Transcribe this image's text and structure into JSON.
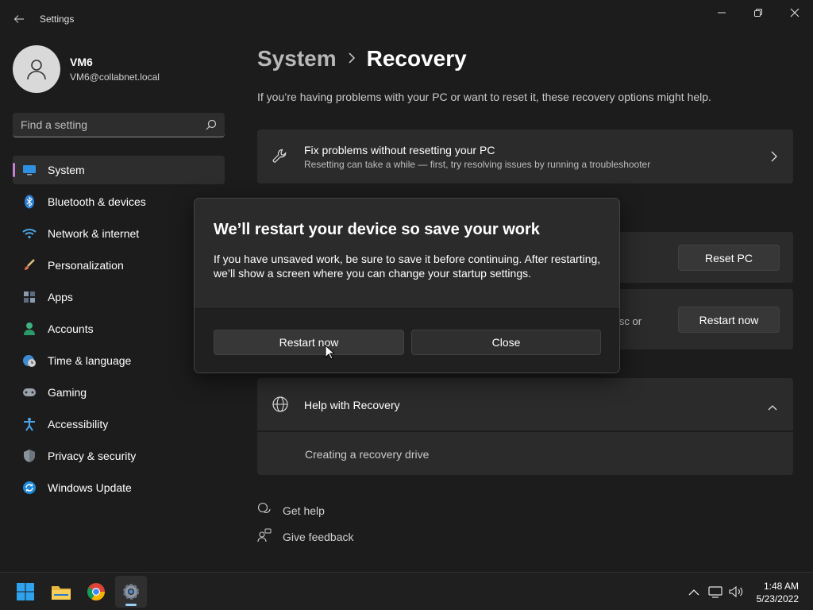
{
  "window": {
    "app_title": "Settings",
    "back_icon": "back-arrow-icon",
    "minimize_icon": "minimize-icon",
    "maximize_icon": "restore-icon",
    "close_icon": "close-icon"
  },
  "profile": {
    "name": "VM6",
    "email": "VM6@collabnet.local"
  },
  "search": {
    "placeholder": "Find a setting"
  },
  "sidebar": {
    "items": [
      {
        "label": "System",
        "icon": "display-icon",
        "active": true
      },
      {
        "label": "Bluetooth & devices",
        "icon": "bluetooth-icon"
      },
      {
        "label": "Network & internet",
        "icon": "wifi-icon"
      },
      {
        "label": "Personalization",
        "icon": "brush-icon"
      },
      {
        "label": "Apps",
        "icon": "apps-icon"
      },
      {
        "label": "Accounts",
        "icon": "person-icon"
      },
      {
        "label": "Time & language",
        "icon": "globe-clock-icon"
      },
      {
        "label": "Gaming",
        "icon": "gamepad-icon"
      },
      {
        "label": "Accessibility",
        "icon": "accessibility-icon"
      },
      {
        "label": "Privacy & security",
        "icon": "shield-icon"
      },
      {
        "label": "Windows Update",
        "icon": "update-icon"
      }
    ]
  },
  "main": {
    "breadcrumb_parent": "System",
    "breadcrumb_current": "Recovery",
    "intro": "If you’re having problems with your PC or want to reset it, these recovery options might help.",
    "fix_card": {
      "title": "Fix problems without resetting your PC",
      "subtitle": "Resetting can take a while — first, try resolving issues by running a troubleshooter"
    },
    "reset_button": "Reset PC",
    "advanced_partial_text": "isc or",
    "restart_button": "Restart now",
    "help_card": {
      "title": "Help with Recovery",
      "link": "Creating a recovery drive"
    },
    "get_help": "Get help",
    "give_feedback": "Give feedback"
  },
  "dialog": {
    "title": "We’ll restart your device so save your work",
    "body": "If you have unsaved work, be sure to save it before continuing. After restarting, we’ll show a screen where you can change your startup settings.",
    "primary_button": "Restart now",
    "secondary_button": "Close"
  },
  "taskbar": {
    "apps": [
      "windows-start-icon",
      "file-explorer-icon",
      "chrome-icon",
      "settings-gear-icon"
    ],
    "time": "1:48 AM",
    "date": "5/23/2022"
  },
  "colors": {
    "accent": "#c57fd3",
    "background": "#1c1c1c",
    "card": "#2b2b2b"
  }
}
